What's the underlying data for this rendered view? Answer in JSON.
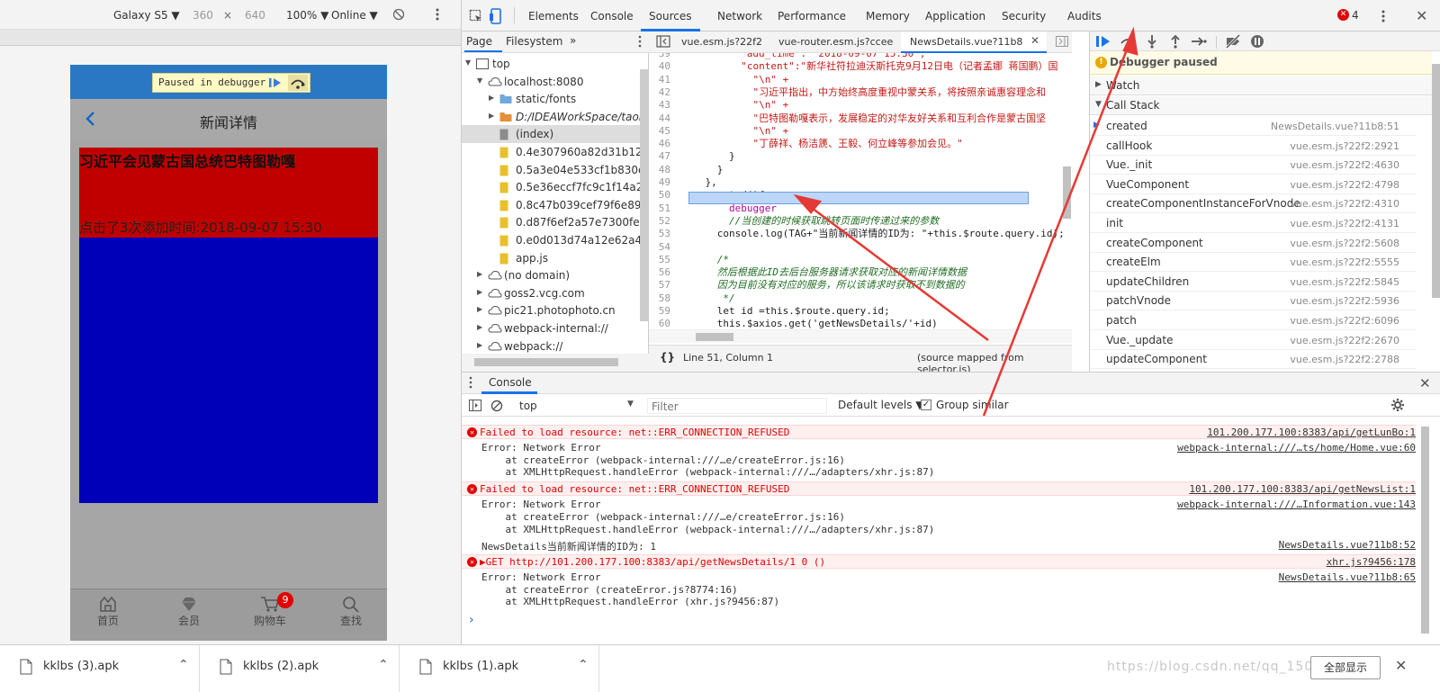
{
  "device_toolbar": {
    "device": "Galaxy S5 ▼",
    "width": "360",
    "times": "×",
    "height": "640",
    "zoom": "100% ▼",
    "network": "Online ▼"
  },
  "phone": {
    "paused_label": "Paused in debugger",
    "nav_title": "新闻详情",
    "news_title": "习近平会见蒙古国总统巴特图勒嘎",
    "news_meta": "点击了3次添加时间:2018-09-07 15:30",
    "tabs": [
      {
        "label": "首页",
        "icon": "home-icon"
      },
      {
        "label": "会员",
        "icon": "member-icon"
      },
      {
        "label": "购物车",
        "icon": "cart-icon",
        "badge": "9"
      },
      {
        "label": "查找",
        "icon": "search-icon"
      }
    ]
  },
  "devtools": {
    "tabs": [
      "Elements",
      "Console",
      "Sources",
      "Network",
      "Performance",
      "Memory",
      "Application",
      "Security",
      "Audits"
    ],
    "active_tab": "Sources",
    "error_count": "4",
    "navigator": {
      "tabs": [
        "Page",
        "Filesystem",
        "»"
      ],
      "tree": [
        {
          "label": "top",
          "indent": 0,
          "type": "frame",
          "arrow": "▼"
        },
        {
          "label": "localhost:8080",
          "indent": 1,
          "type": "cloud",
          "arrow": "▼"
        },
        {
          "label": "static/fonts",
          "indent": 2,
          "type": "folder",
          "arrow": "▶"
        },
        {
          "label": "D:/IDEAWorkSpace/taobao",
          "indent": 2,
          "type": "folder-orange",
          "arrow": "▶"
        },
        {
          "label": "(index)",
          "indent": 2,
          "type": "file-gray",
          "arrow": ""
        },
        {
          "label": "0.4e307960a82d31b12938.h",
          "indent": 2,
          "type": "file",
          "arrow": ""
        },
        {
          "label": "0.5a3e04e533cf1b830e91.ho",
          "indent": 2,
          "type": "file",
          "arrow": ""
        },
        {
          "label": "0.5e36eccf7fc9c1f14a27.hot",
          "indent": 2,
          "type": "file",
          "arrow": ""
        },
        {
          "label": "0.8c47b039cef79f6e89eb.ho",
          "indent": 2,
          "type": "file",
          "arrow": ""
        },
        {
          "label": "0.d87f6ef2a57e7300fe19.ho",
          "indent": 2,
          "type": "file",
          "arrow": ""
        },
        {
          "label": "0.e0d013d74a12e62a4cb9.h",
          "indent": 2,
          "type": "file",
          "arrow": ""
        },
        {
          "label": "app.js",
          "indent": 2,
          "type": "file",
          "arrow": ""
        },
        {
          "label": "(no domain)",
          "indent": 1,
          "type": "cloud",
          "arrow": "▶"
        },
        {
          "label": "goss2.vcg.com",
          "indent": 1,
          "type": "cloud",
          "arrow": "▶"
        },
        {
          "label": "pic21.photophoto.cn",
          "indent": 1,
          "type": "cloud",
          "arrow": "▶"
        },
        {
          "label": "webpack-internal://",
          "indent": 1,
          "type": "cloud",
          "arrow": "▶"
        },
        {
          "label": "webpack://",
          "indent": 1,
          "type": "cloud",
          "arrow": "▶"
        }
      ]
    },
    "editor": {
      "file_tabs": [
        "vue.esm.js?22f2",
        "vue-router.esm.js?ccee",
        "NewsDetails.vue?11b8"
      ],
      "active_file": "NewsDetails.vue?11b8",
      "lines": [
        {
          "n": "39",
          "code": "          \"add_time\": \"2018-09-07 15:30\","
        },
        {
          "n": "40",
          "code": "          \"content\":\"新华社符拉迪沃斯托克9月12日电（记者孟娜 蒋国鹏）国"
        },
        {
          "n": "41",
          "code": "            \"\\n\" +"
        },
        {
          "n": "42",
          "code": "            \"习近平指出，中方始终高度重视中蒙关系，将按照亲诚惠容理念和"
        },
        {
          "n": "43",
          "code": "            \"\\n\" +"
        },
        {
          "n": "44",
          "code": "            \"巴特图勒嘎表示，发展稳定的对华友好关系和互利合作是蒙古国坚"
        },
        {
          "n": "45",
          "code": "            \"\\n\" +"
        },
        {
          "n": "46",
          "code": "            \"丁薛祥、杨洁篪、王毅、何立峰等参加会见。\""
        },
        {
          "n": "47",
          "code": "        }"
        },
        {
          "n": "48",
          "code": "      }"
        },
        {
          "n": "49",
          "code": "    },"
        },
        {
          "n": "50",
          "code": "    created(){"
        },
        {
          "n": "51",
          "code": "        debugger"
        },
        {
          "n": "52",
          "code": "        //当创建的时候获取跳转页面时传递过来的参数"
        },
        {
          "n": "53",
          "code": "      console.log(TAG+\"当前新闻详情的ID为: \"+this.$route.query.id);"
        },
        {
          "n": "54",
          "code": ""
        },
        {
          "n": "55",
          "code": "      /*"
        },
        {
          "n": "56",
          "code": "      然后根据此ID去后台服务器请求获取对应的新闻详情数据"
        },
        {
          "n": "57",
          "code": "      因为目前没有对应的服务，所以该请求时获取不到数据的"
        },
        {
          "n": "58",
          "code": "       */"
        },
        {
          "n": "59",
          "code": "      let id =this.$route.query.id;"
        },
        {
          "n": "60",
          "code": "      this.$axios.get('getNewsDetails/'+id)"
        },
        {
          "n": "61",
          "code": "        .then(response=>{"
        },
        {
          "n": "62",
          "code": ""
        }
      ],
      "status_left": "Line 51, Column 1",
      "status_right": "(source mapped from selector.js)",
      "braces": "{}"
    },
    "debugger": {
      "paused_label": "Debugger paused",
      "watch_label": "Watch",
      "callstack_label": "Call Stack",
      "call_stack": [
        {
          "fn": "created",
          "loc": "NewsDetails.vue?11b8:51"
        },
        {
          "fn": "callHook",
          "loc": "vue.esm.js?22f2:2921"
        },
        {
          "fn": "Vue._init",
          "loc": "vue.esm.js?22f2:4630"
        },
        {
          "fn": "VueComponent",
          "loc": "vue.esm.js?22f2:4798"
        },
        {
          "fn": "createComponentInstanceForVnode",
          "loc": "vue.esm.js?22f2:4310"
        },
        {
          "fn": "init",
          "loc": "vue.esm.js?22f2:4131"
        },
        {
          "fn": "createComponent",
          "loc": "vue.esm.js?22f2:5608"
        },
        {
          "fn": "createElm",
          "loc": "vue.esm.js?22f2:5555"
        },
        {
          "fn": "updateChildren",
          "loc": "vue.esm.js?22f2:5845"
        },
        {
          "fn": "patchVnode",
          "loc": "vue.esm.js?22f2:5936"
        },
        {
          "fn": "patch",
          "loc": "vue.esm.js?22f2:6096"
        },
        {
          "fn": "Vue._update",
          "loc": "vue.esm.js?22f2:2670"
        },
        {
          "fn": "updateComponent",
          "loc": "vue.esm.js?22f2:2788"
        }
      ]
    },
    "console": {
      "tab_label": "Console",
      "context": "top",
      "filter_placeholder": "Filter",
      "levels": "Default levels ▼",
      "group_similar": "Group similar",
      "messages": [
        {
          "kind": "error",
          "text": "Failed to load resource: net::ERR_CONNECTION_REFUSED",
          "src": "101.200.177.100:8383/api/getLunBo:1"
        },
        {
          "kind": "plain",
          "text": "Error: Network Error",
          "src": "webpack-internal:///…ts/home/Home.vue:60"
        },
        {
          "kind": "plain",
          "text": "    at createError (webpack-internal:///…e/createError.js:16)",
          "src": ""
        },
        {
          "kind": "plain",
          "text": "    at XMLHttpRequest.handleError (webpack-internal:///…/adapters/xhr.js:87)",
          "src": ""
        },
        {
          "kind": "error",
          "text": "Failed to load resource: net::ERR_CONNECTION_REFUSED",
          "src": "101.200.177.100:8383/api/getNewsList:1"
        },
        {
          "kind": "plain",
          "text": "Error: Network Error",
          "src": "webpack-internal:///…Information.vue:143"
        },
        {
          "kind": "plain",
          "text": "    at createError (webpack-internal:///…e/createError.js:16)",
          "src": ""
        },
        {
          "kind": "plain",
          "text": "    at XMLHttpRequest.handleError (webpack-internal:///…/adapters/xhr.js:87)",
          "src": ""
        },
        {
          "kind": "log",
          "text": "NewsDetails当前新闻详情的ID为: 1",
          "src": "NewsDetails.vue?11b8:52"
        },
        {
          "kind": "error",
          "text": "▶GET http://101.200.177.100:8383/api/getNewsDetails/1 0 ()",
          "src": "xhr.js?9456:178"
        },
        {
          "kind": "plain",
          "text": "Error: Network Error",
          "src": "NewsDetails.vue?11b8:65"
        },
        {
          "kind": "plain",
          "text": "    at createError (createError.js?8774:16)",
          "src": ""
        },
        {
          "kind": "plain",
          "text": "    at XMLHttpRequest.handleError (xhr.js?9456:87)",
          "src": ""
        }
      ],
      "prompt": "›"
    }
  },
  "downloads": {
    "items": [
      "kklbs (3).apk",
      "kklbs (2).apk",
      "kklbs (1).apk"
    ],
    "show_all": "全部显示",
    "watermark": "https://blog.csdn.net/qq_15096203"
  },
  "colors": {
    "accent": "#1a73e8",
    "error": "#e00000",
    "news_red": "#c00000",
    "news_blue": "#0000b8",
    "phone_header": "#2a78c4",
    "annotation": "#e53935"
  }
}
